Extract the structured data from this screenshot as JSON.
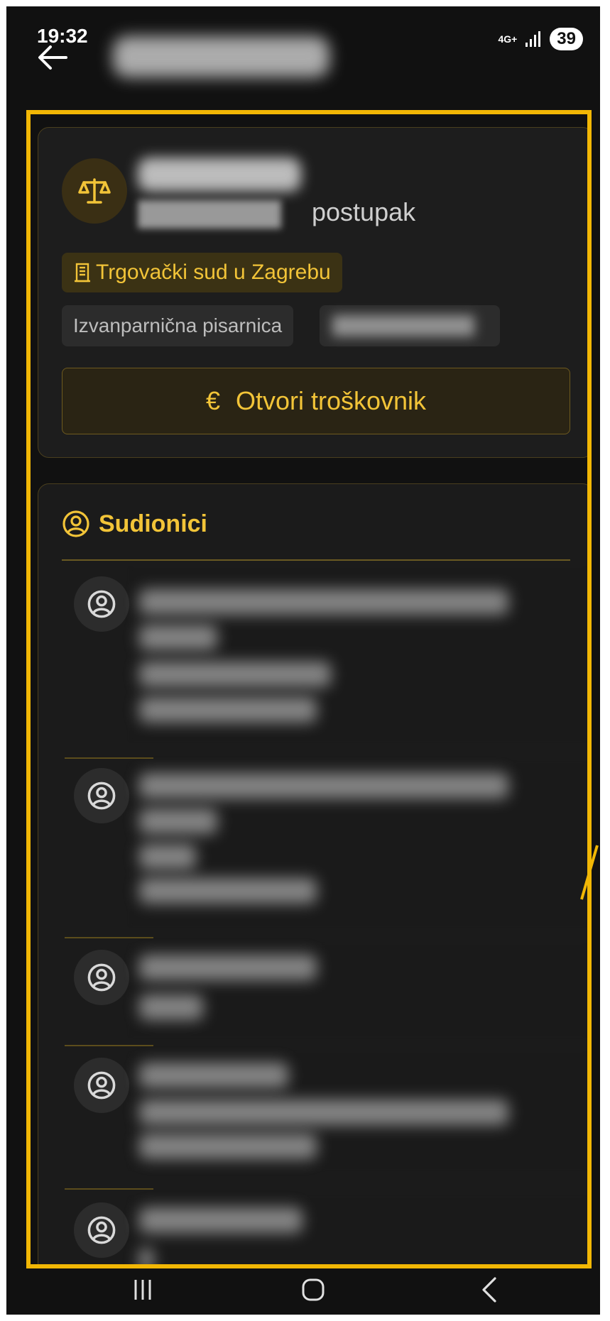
{
  "status_bar": {
    "time": "19:32",
    "network": "4G+",
    "battery": "39",
    "icons": [
      "signal-icon"
    ]
  },
  "app_bar": {
    "back_icon": "arrow-left-icon"
  },
  "case": {
    "icon": "scales-icon",
    "type_suffix": "postupak",
    "court": "Trgovački sud u Zagrebu",
    "court_icon": "building-icon",
    "registry": "Izvanparnična pisarnica",
    "cost_button_label": "Otvori troškovnik",
    "cost_button_icon": "euro-icon"
  },
  "participants": {
    "title": "Sudionici",
    "title_icon": "person-circle-icon",
    "items_icon": "person-circle-icon"
  },
  "nav": {
    "icons": [
      "recents-icon",
      "home-icon",
      "back-icon"
    ]
  },
  "colors": {
    "accent": "#f2c438",
    "background": "#111111",
    "card": "#1d1d1d"
  }
}
